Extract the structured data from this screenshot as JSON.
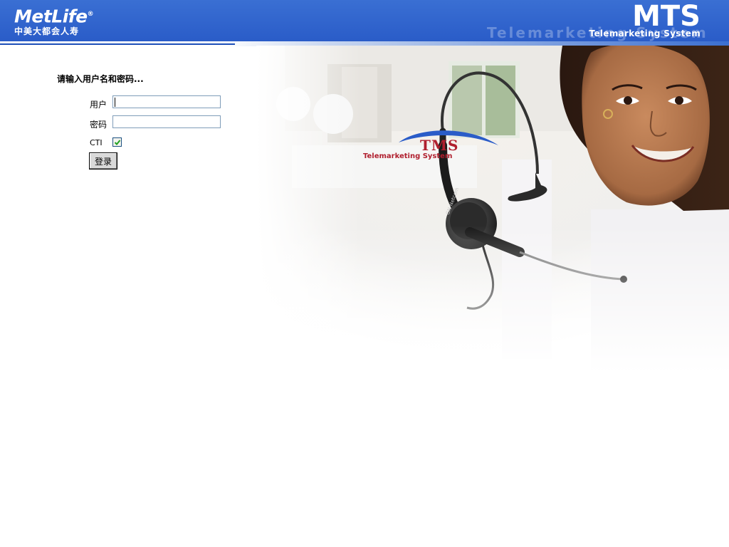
{
  "header": {
    "brand_name": "MetLife",
    "brand_mark": "®",
    "brand_cn": "中美大都会人寿",
    "app_title": "MTS",
    "app_subtitle": "Telemarketing System",
    "watermark": "Telemarketing System"
  },
  "hero": {
    "logo_title": "TMS",
    "logo_subtitle": "Telemarketing System",
    "headset_brand": "GN Netcom"
  },
  "login": {
    "prompt": "请输入用户名和密码...",
    "username_label": "用户",
    "username_value": "",
    "password_label": "密码",
    "password_value": "",
    "cti_label": "CTI",
    "cti_checked": true,
    "submit_label": "登录"
  },
  "colors": {
    "header_blue": "#2d61cc",
    "logo_red": "#b01f2e",
    "logo_blue": "#2a5cc8"
  },
  "icons": {
    "cti_check": "checkmark-icon"
  }
}
